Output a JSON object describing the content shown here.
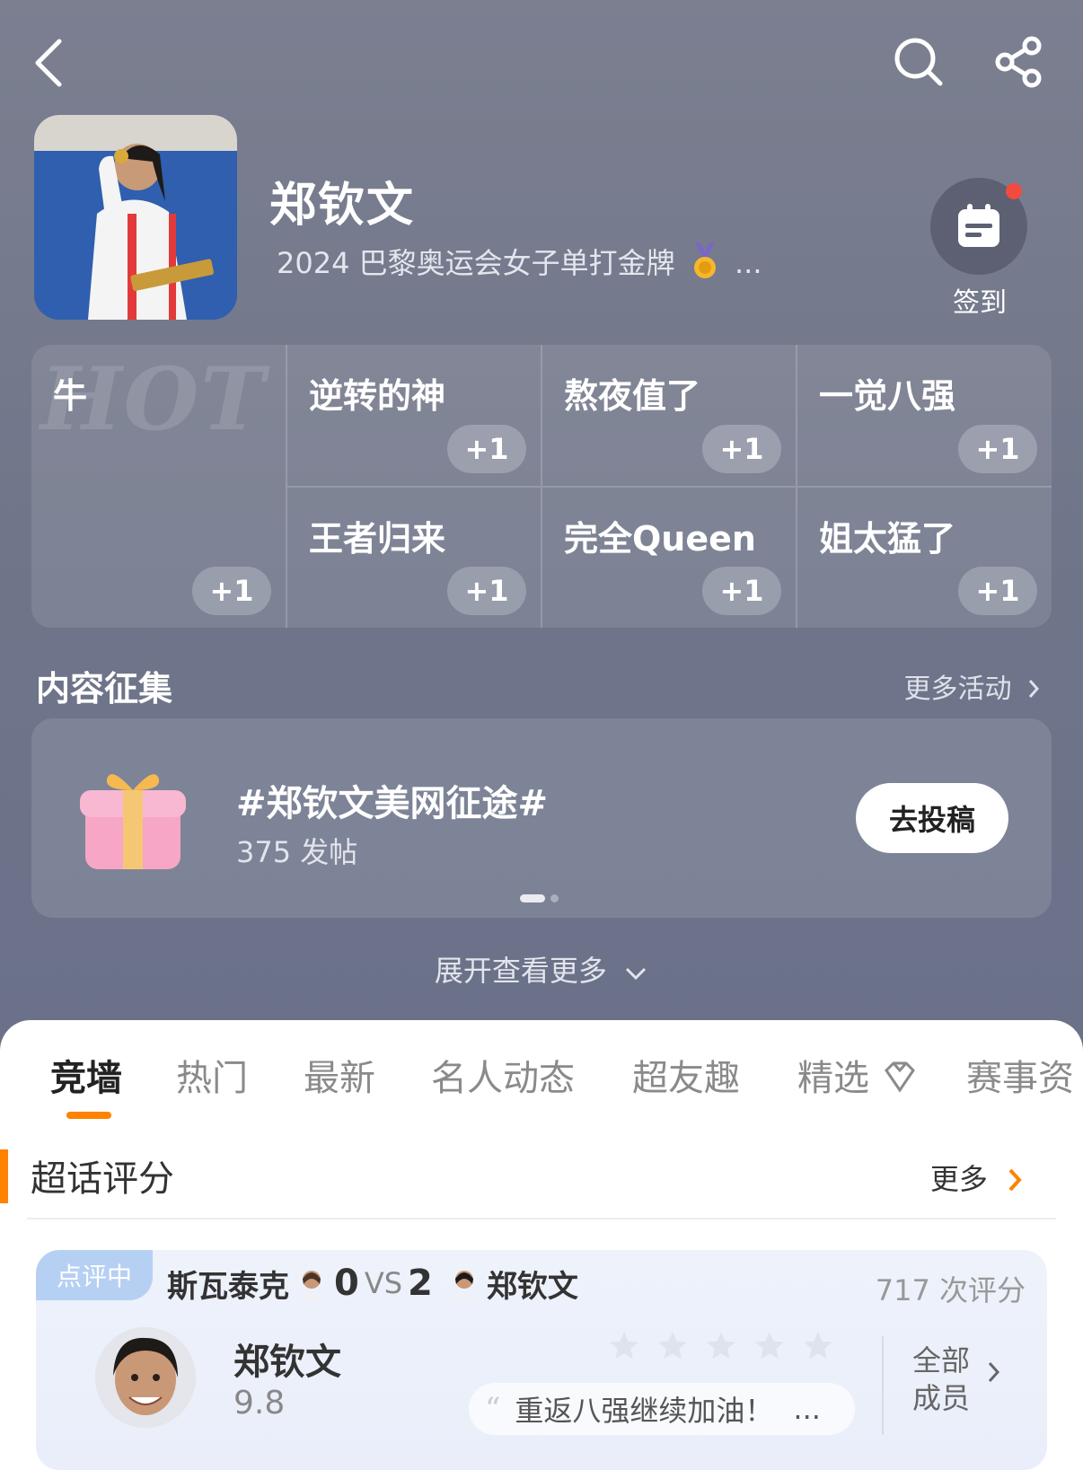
{
  "profile": {
    "name": "郑钦文",
    "subtitle": "2024 巴黎奥运会女子单打金牌",
    "subtitle_ellipsis": "...",
    "checkin_label": "签到"
  },
  "tags": [
    {
      "label": "牛",
      "plus": "+1"
    },
    {
      "label": "逆转的神",
      "plus": "+1"
    },
    {
      "label": "熬夜值了",
      "plus": "+1"
    },
    {
      "label": "一觉八强",
      "plus": "+1"
    },
    {
      "label": "王者归来",
      "plus": "+1"
    },
    {
      "label": "完全Queen",
      "plus": "+1"
    },
    {
      "label": "姐太猛了",
      "plus": "+1"
    }
  ],
  "hot_watermark": "HOT",
  "content_collection": {
    "title": "内容征集",
    "more_label": "更多活动",
    "topic": "#郑钦文美网征途#",
    "count": "375 发帖",
    "submit_label": "去投稿"
  },
  "expand_label": "展开查看更多",
  "tabs": [
    "竞墙",
    "热门",
    "最新",
    "名人动态",
    "超友趣",
    "精选",
    "赛事资"
  ],
  "rating_section": {
    "title": "超话评分",
    "more_label": "更多",
    "badge": "点评中",
    "player_a": "斯瓦泰克",
    "score_a": "0",
    "vs": "VS",
    "score_b": "2",
    "player_b": "郑钦文",
    "rating_count": "717 次评分",
    "rated_name": "郑钦文",
    "rated_score": "9.8",
    "comment": "重返八强继续加油！",
    "comment_ellipsis": "...",
    "all_members": "全部成员"
  },
  "colors": {
    "accent": "#ff8200",
    "badge": "#b6d0f3",
    "red_dot": "#f24a3d"
  }
}
